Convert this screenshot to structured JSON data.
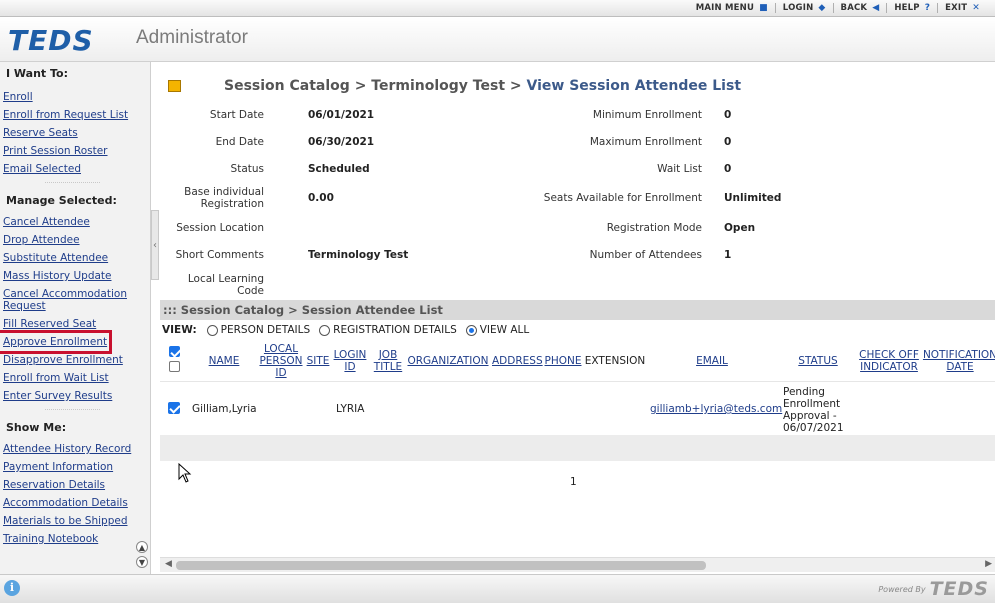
{
  "topnav": [
    {
      "label": "MAIN MENU",
      "icon": "■"
    },
    {
      "label": "LOGIN",
      "icon": "◆"
    },
    {
      "label": "BACK",
      "icon": "◀"
    },
    {
      "label": "HELP",
      "icon": "?"
    },
    {
      "label": "EXIT",
      "icon": "✕"
    }
  ],
  "header": {
    "logo": "TEDS",
    "app_title": "Administrator"
  },
  "sidebar": {
    "i_want_to": "I Want To:",
    "want_links": [
      "Enroll",
      "Enroll from Request List",
      "Reserve Seats",
      "Print Session Roster",
      "Email Selected"
    ],
    "manage_selected": "Manage Selected:",
    "manage_links": [
      "Cancel Attendee",
      "Drop Attendee",
      "Substitute Attendee",
      "Mass History Update",
      "Cancel Accommodation Request",
      "Fill Reserved Seat",
      "Approve Enrollment",
      "Disapprove Enrollment",
      "Enroll from Wait List",
      "Enter Survey Results"
    ],
    "show_me": "Show Me:",
    "show_links": [
      "Attendee History Record",
      "Payment Information",
      "Reservation Details",
      "Accommodation Details",
      "Materials to be Shipped",
      "Training Notebook"
    ]
  },
  "breadcrumb": {
    "part1": "Session Catalog",
    "sep": ">",
    "part2": "Terminology Test",
    "current": "View Session Attendee List"
  },
  "details_left": [
    {
      "label": "Start Date",
      "value": "06/01/2021"
    },
    {
      "label": "End Date",
      "value": "06/30/2021"
    },
    {
      "label": "Status",
      "value": "Scheduled"
    },
    {
      "label": "Base individual Registration",
      "value": "0.00"
    },
    {
      "label": "Session Location",
      "value": ""
    },
    {
      "label": "Short Comments",
      "value": "Terminology Test"
    },
    {
      "label": "Local Learning Code",
      "value": ""
    }
  ],
  "details_right": [
    {
      "label": "Minimum Enrollment",
      "value": "0"
    },
    {
      "label": "Maximum Enrollment",
      "value": "0"
    },
    {
      "label": "Wait List",
      "value": "0"
    },
    {
      "label": "Seats Available for Enrollment",
      "value": "Unlimited"
    },
    {
      "label": "Registration Mode",
      "value": "Open"
    },
    {
      "label": "Number of Attendees",
      "value": "1"
    }
  ],
  "section_title": "::: Session Catalog > Session Attendee List",
  "view": {
    "label": "VIEW:",
    "options": [
      "PERSON DETAILS",
      "REGISTRATION DETAILS",
      "VIEW ALL"
    ],
    "selected": "VIEW ALL"
  },
  "columns": [
    "NAME",
    "LOCAL PERSON ID",
    "SITE",
    "LOGIN ID",
    "JOB TITLE",
    "ORGANIZATION",
    "ADDRESS",
    "PHONE",
    "EXTENSION",
    "EMAIL",
    "STATUS",
    "CHECK OFF INDICATOR",
    "NOTIFICATION DATE"
  ],
  "rows": [
    {
      "checked": true,
      "name": "Gilliam,Lyria",
      "login_id": "LYRIA",
      "email": "gilliamb+lyria@teds.com",
      "status": "Pending Enrollment Approval - 06/07/2021"
    }
  ],
  "pager": {
    "page": "1"
  },
  "footer": {
    "powered_by": "Powered By",
    "logo": "TEDS"
  }
}
